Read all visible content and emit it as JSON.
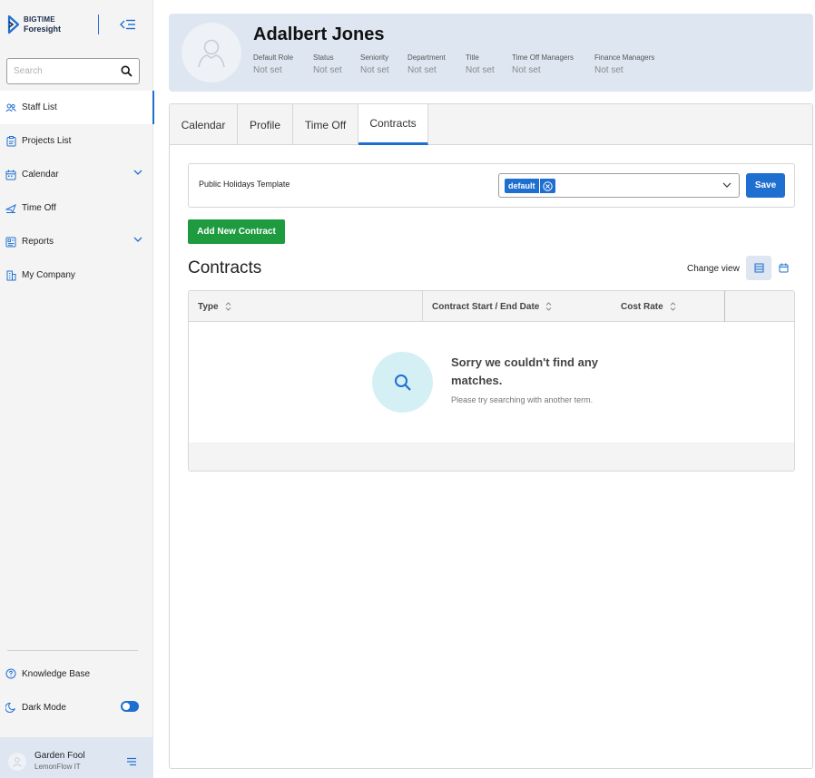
{
  "sidebar": {
    "logo_line1": "BIGTIME",
    "logo_line2": "Foresight",
    "search_placeholder": "Search",
    "items": [
      {
        "label": "Staff List"
      },
      {
        "label": "Projects List"
      },
      {
        "label": "Calendar"
      },
      {
        "label": "Time Off"
      },
      {
        "label": "Reports"
      },
      {
        "label": "My Company"
      }
    ],
    "knowledge_base": "Knowledge Base",
    "dark_mode": "Dark Mode",
    "user_name": "Garden Fool",
    "user_org": "LemonFlow IT"
  },
  "profile": {
    "name": "Adalbert Jones",
    "fields": [
      {
        "label": "Default Role",
        "value": "Not set"
      },
      {
        "label": "Status",
        "value": "Not set"
      },
      {
        "label": "Seniority",
        "value": "Not set"
      },
      {
        "label": "Department",
        "value": "Not set"
      },
      {
        "label": "Title",
        "value": "Not set"
      },
      {
        "label": "Time Off Managers",
        "value": "Not set"
      },
      {
        "label": "Finance Managers",
        "value": "Not set"
      }
    ]
  },
  "tabs": [
    {
      "label": "Calendar"
    },
    {
      "label": "Profile"
    },
    {
      "label": "Time Off"
    },
    {
      "label": "Contracts"
    }
  ],
  "holidays": {
    "label": "Public Holidays Template",
    "selected": "default",
    "save_label": "Save"
  },
  "contracts": {
    "add_label": "Add New Contract",
    "title": "Contracts",
    "change_view": "Change view",
    "columns": [
      "Type",
      "Contract Start / End Date",
      "Cost Rate"
    ],
    "empty_title": "Sorry we couldn't find any matches.",
    "empty_sub": "Please try searching with another term."
  }
}
